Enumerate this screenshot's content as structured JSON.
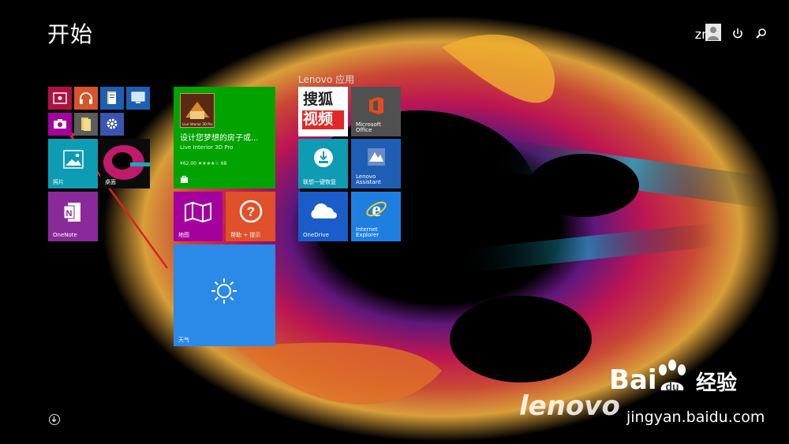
{
  "header": {
    "title": "开始",
    "username": "zmk"
  },
  "icons": {
    "power": "power-icon",
    "search": "search-icon",
    "scroll": "chevron-down-circle-icon"
  },
  "tiles": {
    "photos_label": "照片",
    "desktop_label": "桌面",
    "onenote_label": "OneNote",
    "store_app_title": "设计您梦想的房子或...",
    "store_app_name": "Live Interior 3D Pro",
    "store_app_price": "¥62.00 ★★★★☆ 68",
    "store_app_thumb_text": "Live Interior 3D Pro",
    "maps_label": "地图",
    "help_label": "帮助 + 提示",
    "weather_label": "天气",
    "group_label": "Lenovo 应用",
    "sohu_text_1": "搜狐",
    "sohu_text_2": "视频",
    "office_label_1": "Microsoft",
    "office_label_2": "Office",
    "onekey_label": "联想一键恢复",
    "assistant_label_1": "Lenovo",
    "assistant_label_2": "Assistant",
    "onedrive_label": "OneDrive",
    "ie_label_1": "Internet",
    "ie_label_2": "Explorer"
  },
  "watermark": {
    "brand": "lenovo",
    "baidu_text": "Bai",
    "baidu_cn": "经验",
    "url": "jingyan.baidu.com"
  },
  "colors": {
    "green": "#00a300",
    "magenta": "#a4009e",
    "orange": "#d9532b",
    "blue": "#2b8ae8",
    "teal": "#00a3b8",
    "darkred": "#b0123f",
    "gray": "#5c5c5c",
    "azure": "#1e5fb5"
  }
}
